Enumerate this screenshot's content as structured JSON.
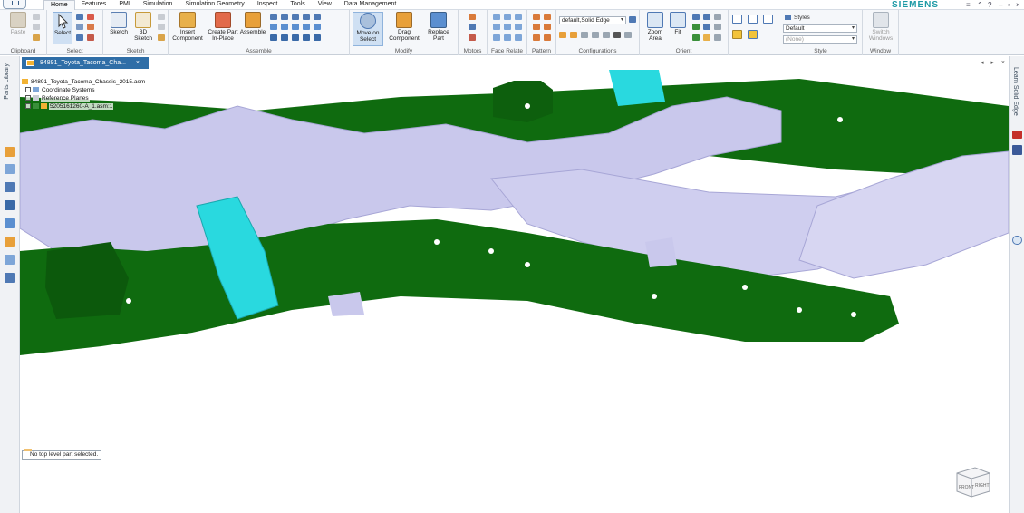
{
  "brand": "SIEMENS",
  "tabs": [
    "Home",
    "Features",
    "PMI",
    "Simulation",
    "Simulation Geometry",
    "Inspect",
    "Tools",
    "View",
    "Data Management"
  ],
  "ribbon": {
    "clipboard": {
      "paste": "Paste",
      "group": "Clipboard"
    },
    "select": {
      "select": "Select",
      "group": "Select"
    },
    "sketch": {
      "sketch": "Sketch",
      "sketch3d": "3D Sketch",
      "group": "Sketch"
    },
    "assemble": {
      "insert": "Insert Component",
      "create": "Create Part In-Place",
      "assemble": "Assemble",
      "group": "Assemble"
    },
    "modify": {
      "move": "Move on Select",
      "drag": "Drag Component",
      "replace": "Replace Part",
      "group": "Modify"
    },
    "motors": {
      "group": "Motors"
    },
    "face_relate": {
      "group": "Face Relate"
    },
    "pattern": {
      "group": "Pattern"
    },
    "configurations": {
      "value": "default,Solid Edge",
      "group": "Configurations"
    },
    "orient": {
      "zoom": "Zoom Area",
      "fit": "Fit",
      "group": "Orient"
    },
    "style": {
      "styles_label": "Styles",
      "style_value": "Default",
      "none_value": "(None)",
      "group": "Style"
    },
    "window": {
      "switch": "Switch Windows",
      "group": "Window"
    }
  },
  "left_panel_label": "Parts Library",
  "right_panel_label": "Learn Solid Edge",
  "document_tab": "84891_Toyota_Tacoma_Cha...",
  "tree": {
    "root": "84891_Toyota_Tacoma_Chassis_2015.asm",
    "items": [
      "Coordinate Systems",
      "Reference Planes",
      "5205161260-A_1.asm:1"
    ]
  },
  "status_text": "No top level part selected.",
  "viewcube": {
    "front": "FRONT",
    "right": "RIGHT"
  },
  "colors": {
    "frame_green": "#0f6b0f",
    "crossmember_lavender": "#c9c8ec",
    "bracket_cyan": "#29d9df",
    "accent_blue": "#2f6ea7"
  }
}
